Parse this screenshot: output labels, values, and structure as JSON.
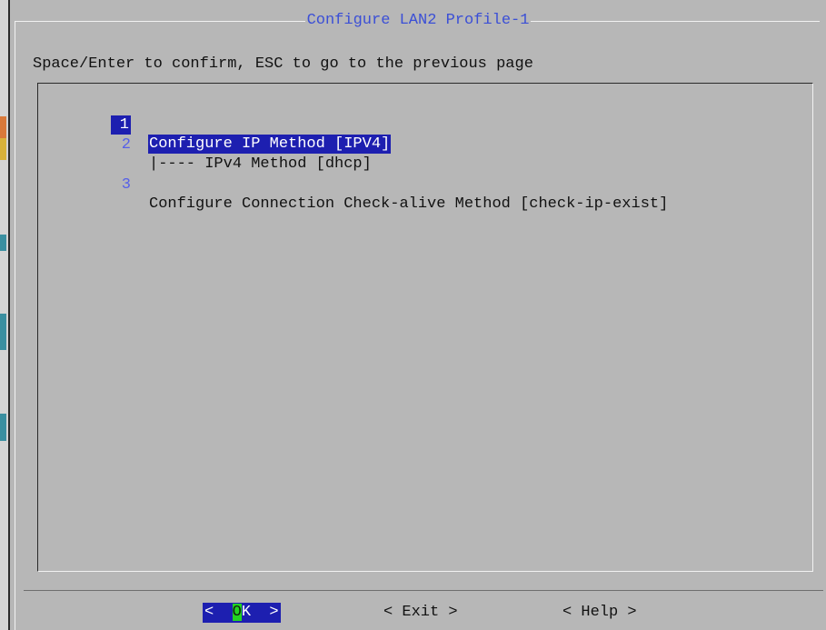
{
  "dialog": {
    "title": "Configure LAN2 Profile-1",
    "instructions": "Space/Enter to confirm, ESC to go to the previous page"
  },
  "menu": {
    "items": [
      {
        "tag": "1",
        "label": "Configure IP Method [IPV4]",
        "selected": true
      },
      {
        "tag": "2",
        "label": "|---- IPv4 Method [dhcp]",
        "selected": false
      },
      {
        "tag": "3",
        "label": "Configure Connection Check-alive Method [check-ip-exist]",
        "selected": false
      }
    ]
  },
  "buttons": {
    "ok": {
      "left": "<  ",
      "hotkey": "O",
      "rest": "K  >"
    },
    "exit": "< Exit >",
    "help": "< Help >"
  },
  "colors": {
    "background": "#b7b7b7",
    "selection": "#1d1fb0",
    "tag_text": "#5660e8",
    "title_text": "#3b4fd6",
    "hotkey": "#22d422"
  }
}
